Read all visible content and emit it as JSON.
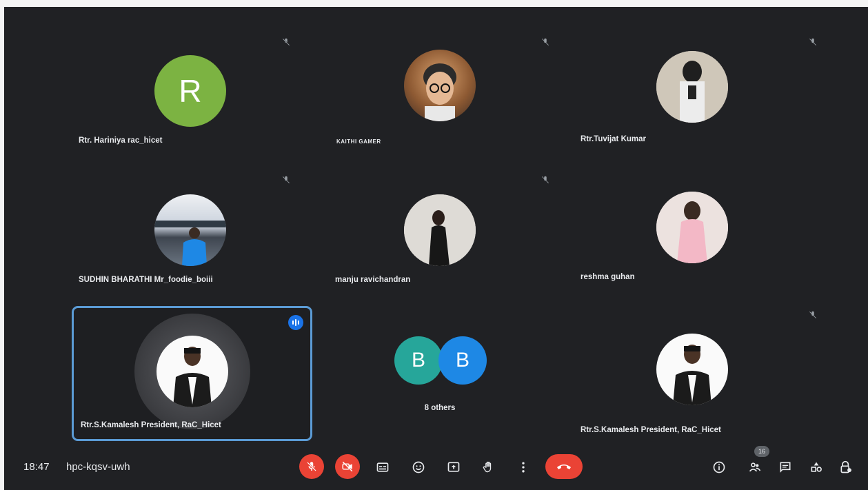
{
  "participants": [
    {
      "name": "Rtr. Hariniya rac_hicet",
      "avatar_letter": "R",
      "avatar_color": "#7cb342",
      "muted": true
    },
    {
      "name": "KAITHI GAMER",
      "avatar_icon": "person-with-glasses-photo",
      "muted": true
    },
    {
      "name": "Rtr.Tuvijat Kumar",
      "avatar_icon": "person-photo",
      "muted": true
    },
    {
      "name": "SUDHIN BHARATHI Mr_foodie_boiii",
      "avatar_icon": "person-by-lake-photo",
      "muted": true
    },
    {
      "name": "manju ravichandran",
      "avatar_icon": "person-photo",
      "muted": true
    },
    {
      "name": "reshma guhan",
      "avatar_icon": "person-photo",
      "muted": false
    },
    {
      "name": "Rtr.S.Kamalesh President, RaC_Hicet",
      "avatar_icon": "person-in-suit-photo",
      "speaking": true
    },
    {
      "name": "Rtr.S.Kamalesh President, RaC_Hicet",
      "avatar_icon": "person-in-suit-photo",
      "muted": true
    }
  ],
  "others": {
    "label": "8 others",
    "avatars": [
      {
        "letter": "B",
        "color": "#26a69a"
      },
      {
        "letter": "B",
        "color": "#1e88e5"
      }
    ]
  },
  "bottom_bar": {
    "time": "18:47",
    "separator": "|",
    "meeting_code": "hpc-kqsv-uwh",
    "participant_count": "16"
  },
  "colors": {
    "background": "#202124",
    "danger": "#ea4335",
    "active_border": "#5b9bd5",
    "speaking": "#1a73e8"
  }
}
